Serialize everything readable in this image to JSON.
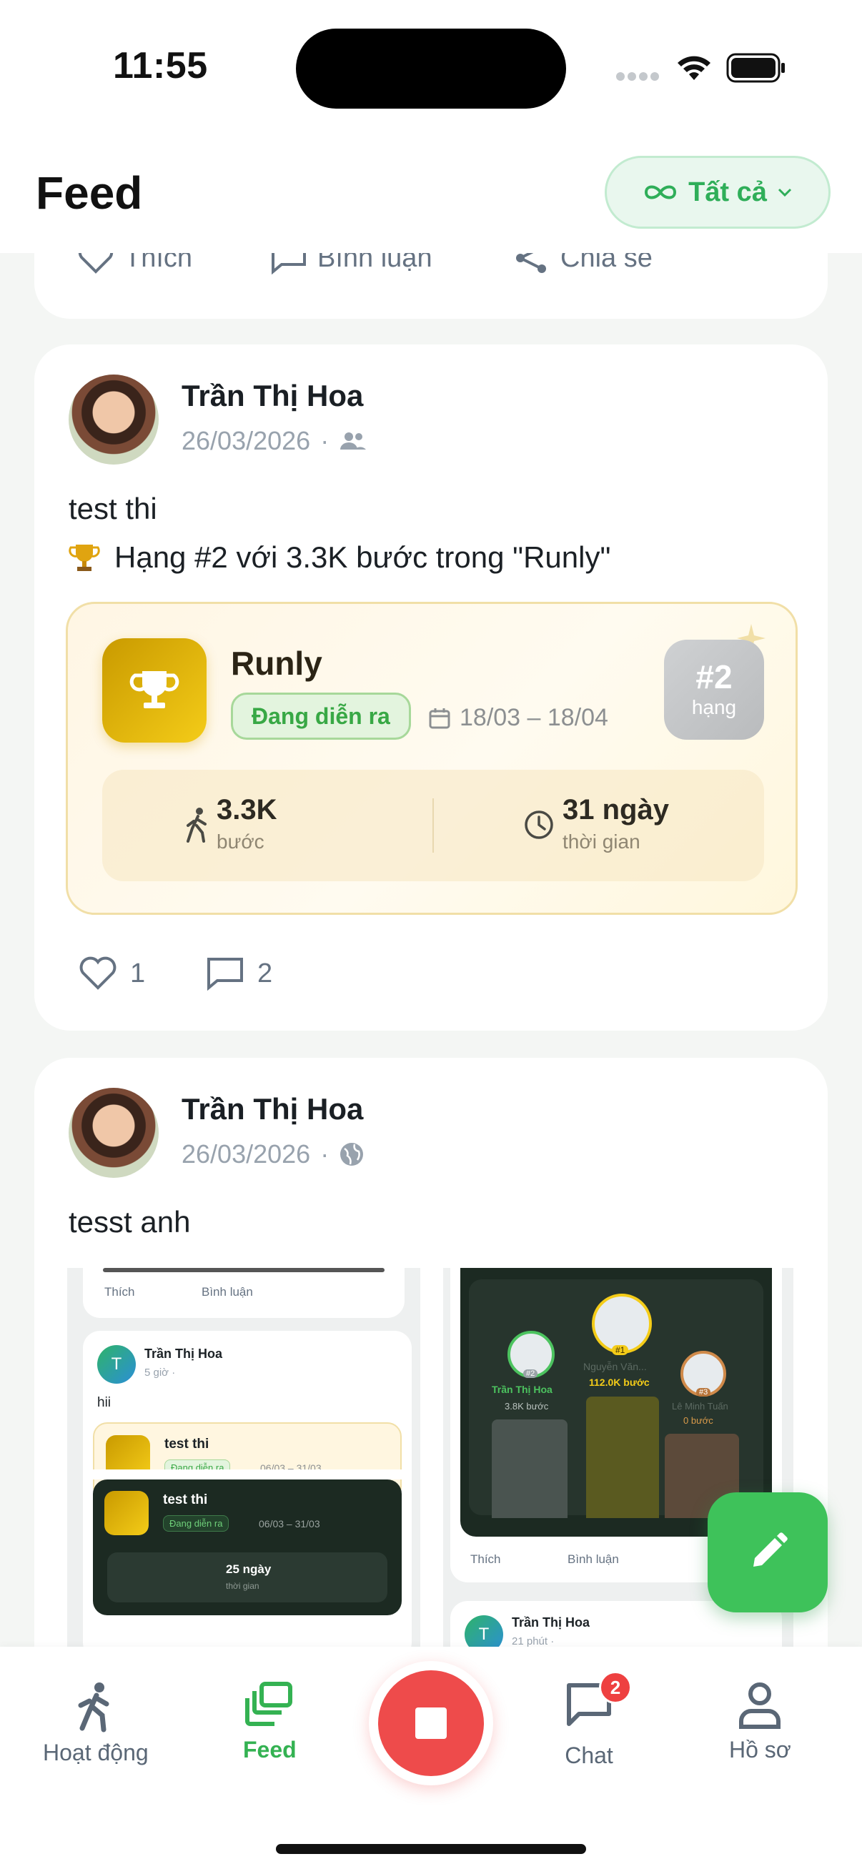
{
  "status_bar": {
    "time": "11:55"
  },
  "header": {
    "title": "Feed",
    "filter_label": "Tất cả"
  },
  "top_card": {
    "like": "Thích",
    "comment": "Bình luận",
    "share": "Chia sẻ"
  },
  "posts": [
    {
      "author": "Trần Thị Hoa",
      "date": "26/03/2026",
      "visibility_icon": "friends-icon",
      "text_line1": "test thi",
      "text_line2": "Hạng #2 với 3.3K bước trong \"Runly\"",
      "challenge": {
        "name": "Runly",
        "status": "Đang diễn ra",
        "dates": "18/03 – 18/04",
        "rank": "#2",
        "rank_label": "hạng",
        "steps_value": "3.3K",
        "steps_label": "bước",
        "duration_value": "31 ngày",
        "duration_label": "thời gian"
      },
      "likes": "1",
      "comments": "2"
    },
    {
      "author": "Trần Thị Hoa",
      "date": "26/03/2026",
      "visibility_icon": "globe-icon",
      "text": "tesst anh",
      "embedded_left": {
        "like": "Thích",
        "comment": "Bình luận",
        "author": "Trần Thị Hoa",
        "avatar_letter": "T",
        "time": "5 giờ ·",
        "text": "hii",
        "challenge1_name": "test thi",
        "challenge1_status": "Đang diễn ra",
        "challenge1_dates": "06/03 – 31/03",
        "challenge2_name": "test thi",
        "challenge2_status": "Đang diễn ra",
        "challenge2_dates": "06/03 – 31/03",
        "challenge2_days": "25 ngày",
        "challenge2_days_label": "thời gian"
      },
      "embedded_right": {
        "first_name": "Nguyễn Văn...",
        "first_rank": "#1",
        "first_steps": "112.0K bước",
        "second_name": "Trần Thị Hoa",
        "second_rank": "#2",
        "second_steps": "3.8K bước",
        "third_name": "Lê Minh Tuấn",
        "third_rank": "#3",
        "third_steps": "0 bước",
        "like": "Thích",
        "comment": "Bình luận",
        "next_author": "Trần Thị Hoa",
        "next_avatar_letter": "T",
        "next_time": "21 phút ·"
      }
    }
  ],
  "bottom_nav": {
    "activity": "Hoạt động",
    "feed": "Feed",
    "chat": "Chat",
    "chat_badge": "2",
    "profile": "Hồ sơ"
  },
  "colors": {
    "accent": "#3ec25a",
    "record": "#ee4b4b",
    "gold": "#f4cc18"
  }
}
